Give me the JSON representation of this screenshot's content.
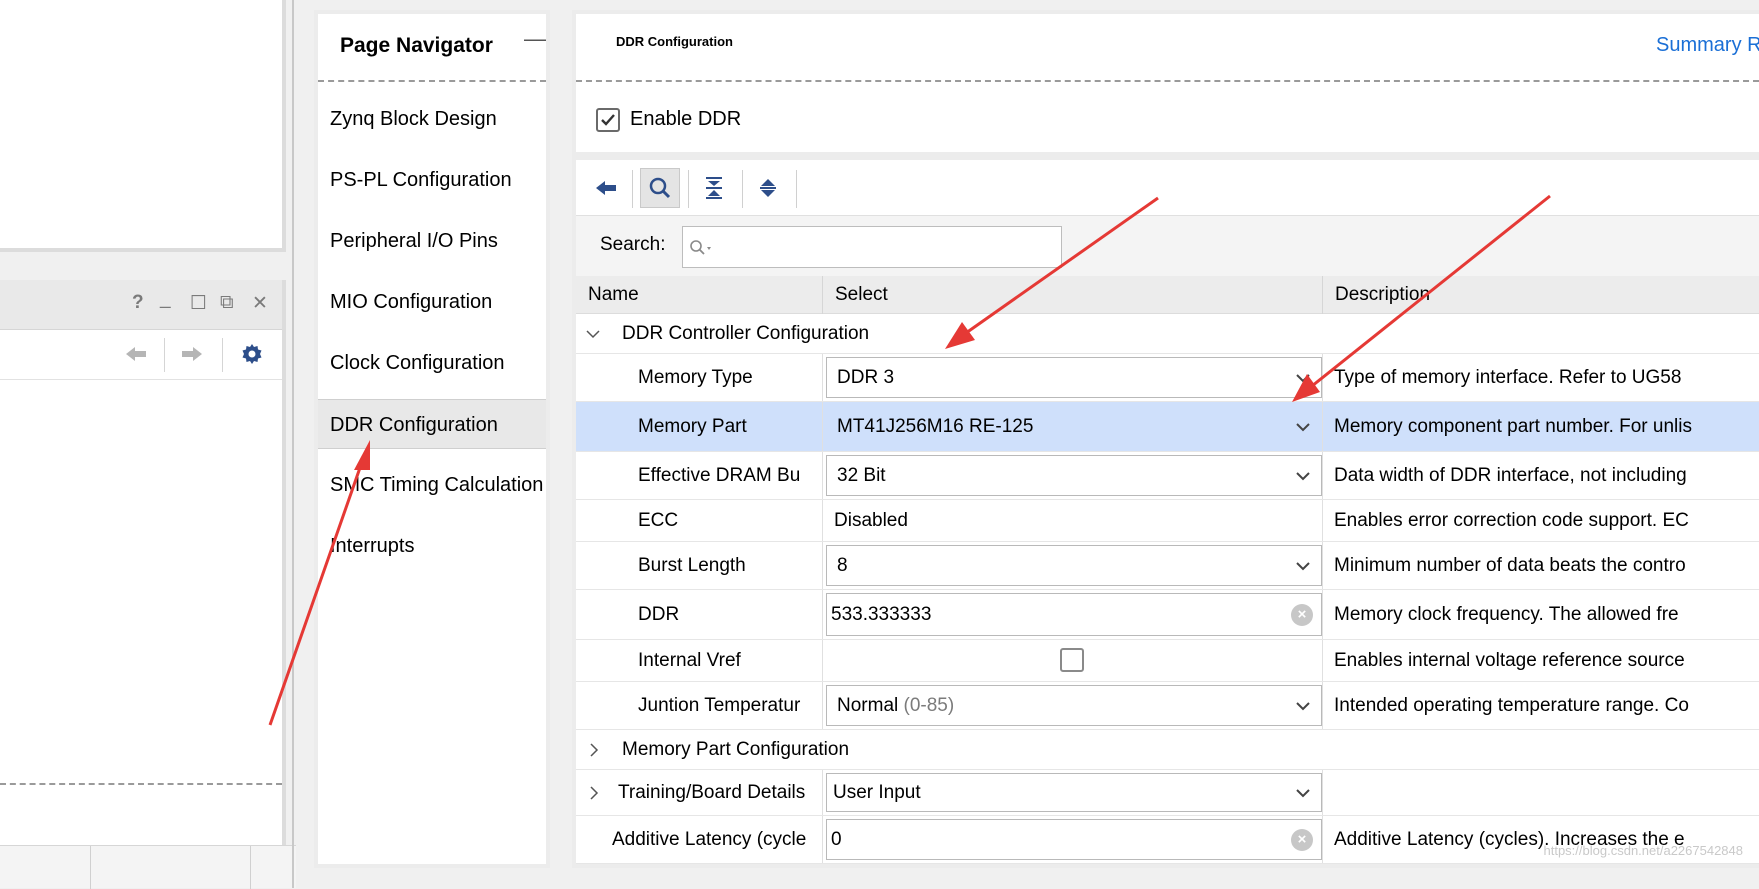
{
  "left_panel": {
    "window_icons": {
      "help": "?",
      "minimize": "_",
      "restore": "☐",
      "float": "⧉",
      "close": "✕"
    },
    "toolbar": {
      "back_icon": "arrow-left-icon",
      "forward_icon": "arrow-right-icon",
      "settings_icon": "gear-icon"
    }
  },
  "page_navigator": {
    "title": "Page Navigator",
    "minimize": "—",
    "items": [
      {
        "label": "Zynq Block Design",
        "selected": false
      },
      {
        "label": "PS-PL Configuration",
        "selected": false
      },
      {
        "label": "Peripheral I/O Pins",
        "selected": false
      },
      {
        "label": "MIO Configuration",
        "selected": false
      },
      {
        "label": "Clock Configuration",
        "selected": false
      },
      {
        "label": "DDR Configuration",
        "selected": true
      },
      {
        "label": "SMC Timing Calculation",
        "selected": false
      },
      {
        "label": "Interrupts",
        "selected": false
      }
    ]
  },
  "main": {
    "title": "DDR Configuration",
    "summary_link": "Summary R",
    "enable_ddr": {
      "label": "Enable DDR",
      "checked": true
    },
    "toolbar": [
      "back-icon",
      "search-icon",
      "collapse-all-icon",
      "expand-all-icon"
    ],
    "search": {
      "label": "Search:",
      "placeholder": ""
    },
    "grid": {
      "columns": [
        "Name",
        "Select",
        "Description"
      ],
      "rows": [
        {
          "kind": "group",
          "expanded": true,
          "name": "DDR Controller Configuration"
        },
        {
          "kind": "combo",
          "name": "Memory Type",
          "value": "DDR 3",
          "description": "Type of memory interface. Refer to UG58"
        },
        {
          "kind": "combo",
          "name": "Memory Part",
          "value": "MT41J256M16 RE-125",
          "description": "Memory component part number. For unlis",
          "selected": true
        },
        {
          "kind": "combo",
          "name": "Effective DRAM Bu",
          "value": "32 Bit",
          "description": "Data width of DDR interface, not including"
        },
        {
          "kind": "text",
          "name": "ECC",
          "value": "Disabled",
          "description": "Enables error correction code support. EC"
        },
        {
          "kind": "combo",
          "name": "Burst Length",
          "value": "8",
          "description": "Minimum number of data beats the contro"
        },
        {
          "kind": "input",
          "name": "DDR",
          "value": "533.333333",
          "description": "Memory clock frequency. The allowed fre"
        },
        {
          "kind": "checkbox",
          "name": "Internal Vref",
          "checked": false,
          "description": "Enables internal voltage reference source"
        },
        {
          "kind": "combo",
          "name": "Juntion Temperatur",
          "value": "Normal",
          "value_extra": "(0-85)",
          "description": "Intended operating temperature range. Co"
        },
        {
          "kind": "group",
          "expanded": false,
          "name": "Memory Part Configuration"
        },
        {
          "kind": "group-combo",
          "expanded": false,
          "name": "Training/Board Details",
          "value": "User Input",
          "description": ""
        },
        {
          "kind": "input-top",
          "name": "Additive Latency (cycle",
          "value": "0",
          "description": "Additive Latency (cycles). Increases the e"
        }
      ]
    }
  },
  "watermark": "https://blog.csdn.net/a2267542848",
  "colors": {
    "selected_row": "#cfe0fb",
    "link": "#1a6fd6",
    "annotation_arrow": "#e53935",
    "toolbar_icon": "#2d4e8a"
  }
}
